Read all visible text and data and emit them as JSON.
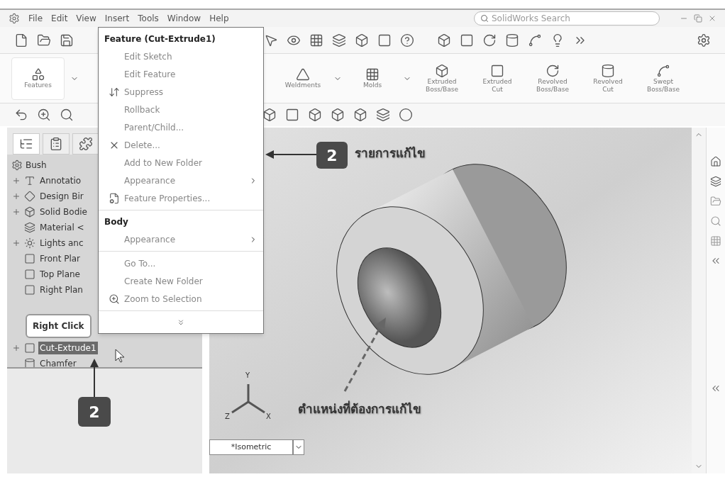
{
  "menubar": {
    "items": [
      "File",
      "Edit",
      "View",
      "Insert",
      "Tools",
      "Window",
      "Help"
    ],
    "search": {
      "placeholder": "SolidWorks Search"
    }
  },
  "command_manager": [
    {
      "kind": "features",
      "lines": [
        "Features"
      ],
      "dropdown": true
    },
    {
      "kind": "weldments",
      "lines": [
        "Weldments"
      ],
      "dropdown": true
    },
    {
      "kind": "molds",
      "lines": [
        "Molds"
      ],
      "dropdown": true
    },
    {
      "kind": "extrude-boss",
      "lines": [
        "Extruded",
        "Boss/Base"
      ],
      "dropdown": false
    },
    {
      "kind": "extrude-cut",
      "lines": [
        "Extruded",
        "Cut"
      ],
      "dropdown": false
    },
    {
      "kind": "revolve-boss",
      "lines": [
        "Revolved",
        "Boss/Base"
      ],
      "dropdown": false
    },
    {
      "kind": "revolve-cut",
      "lines": [
        "Revolved",
        "Cut"
      ],
      "dropdown": false
    },
    {
      "kind": "sweep",
      "lines": [
        "Swept",
        "Boss/Base"
      ],
      "dropdown": false
    }
  ],
  "panel_tabs": [
    {
      "kind": "tree",
      "selected": true
    },
    {
      "kind": "property",
      "selected": false
    },
    {
      "kind": "config",
      "selected": false
    }
  ],
  "feature_tree": {
    "root": "Bush",
    "items": [
      {
        "kind": "annotation",
        "label": "Annotatio",
        "expandable": true,
        "selected": false
      },
      {
        "kind": "binder",
        "label": "Design Bir",
        "expandable": true,
        "selected": false
      },
      {
        "kind": "bodies",
        "label": "Solid Bodie",
        "expandable": true,
        "selected": false
      },
      {
        "kind": "material",
        "label": "Material <",
        "expandable": false,
        "selected": false
      },
      {
        "kind": "lights",
        "label": "Lights anc",
        "expandable": true,
        "selected": false
      },
      {
        "kind": "plane",
        "label": "Front Plar",
        "expandable": false,
        "selected": false
      },
      {
        "kind": "plane",
        "label": "Top Plane",
        "expandable": false,
        "selected": false
      },
      {
        "kind": "plane",
        "label": "Right Plan",
        "expandable": false,
        "selected": false
      },
      {
        "kind": "cut",
        "label": "Cut-Extrude1",
        "expandable": true,
        "selected": true
      },
      {
        "kind": "chamfer",
        "label": "Chamfer",
        "expandable": false,
        "selected": false
      }
    ]
  },
  "context_menu": {
    "title": "Feature (Cut-Extrude1)",
    "sections": [
      {
        "items": [
          {
            "kind": "plain",
            "label": "Edit Sketch",
            "submenu": false
          },
          {
            "kind": "plain",
            "label": "Edit Feature",
            "submenu": false
          },
          {
            "kind": "suppress",
            "label": "Suppress",
            "submenu": false
          },
          {
            "kind": "plain",
            "label": "Rollback",
            "submenu": false
          },
          {
            "kind": "plain",
            "label": "Parent/Child...",
            "submenu": false
          },
          {
            "kind": "delete",
            "label": "Delete...",
            "submenu": false
          },
          {
            "kind": "plain",
            "label": "Add to New Folder",
            "submenu": false
          },
          {
            "kind": "plain",
            "label": "Appearance",
            "submenu": true
          },
          {
            "kind": "properties",
            "label": "Feature Properties...",
            "submenu": false
          }
        ]
      },
      {
        "heading": "Body",
        "items": [
          {
            "kind": "plain",
            "label": "Appearance",
            "submenu": true
          }
        ]
      },
      {
        "items": [
          {
            "kind": "plain",
            "label": "Go To...",
            "submenu": false
          },
          {
            "kind": "plain",
            "label": "Create New Folder",
            "submenu": false
          },
          {
            "kind": "zoom",
            "label": "Zoom to Selection",
            "submenu": false
          }
        ]
      }
    ]
  },
  "viewport": {
    "triad": {
      "y": "Y",
      "z": "Z",
      "x": "X"
    },
    "view": "*Isometric"
  },
  "annotations": {
    "menu_step": {
      "number": "2",
      "text": "รายการแก้ไข"
    },
    "tree_step": {
      "number": "2"
    },
    "right_click": "Right Click",
    "location_label": "ตำแหน่งที่ต้องการแก้ไข"
  }
}
